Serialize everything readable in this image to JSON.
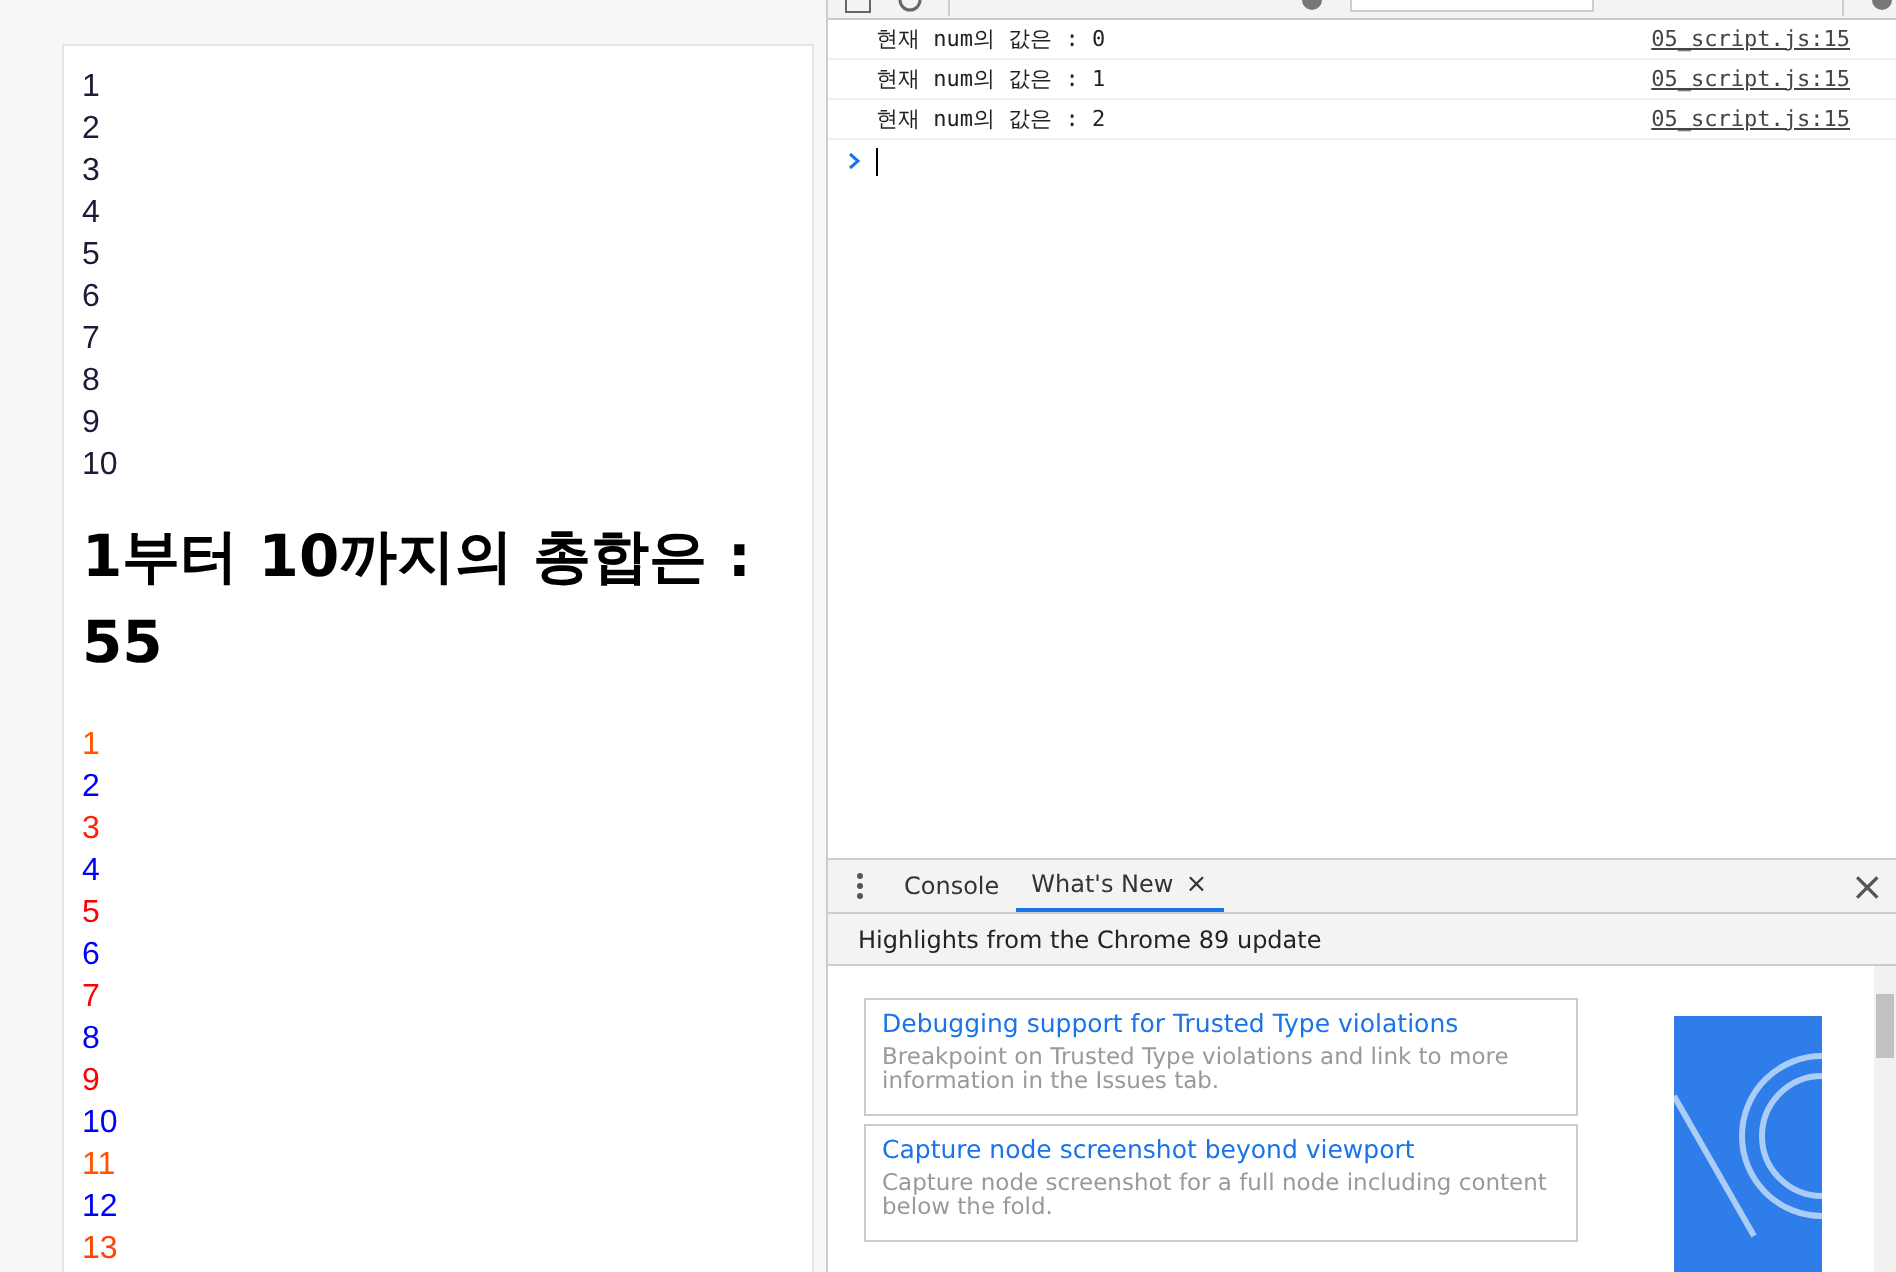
{
  "page": {
    "first_list": [
      "1",
      "2",
      "3",
      "4",
      "5",
      "6",
      "7",
      "8",
      "9",
      "10"
    ],
    "heading": "1부터 10까지의 총합은 : 55",
    "second_list": [
      {
        "text": "1",
        "color": "#ff5500"
      },
      {
        "text": "2",
        "color": "#0000ff"
      },
      {
        "text": "3",
        "color": "#ff2200"
      },
      {
        "text": "4",
        "color": "#0000ff"
      },
      {
        "text": "5",
        "color": "#ff0000"
      },
      {
        "text": "6",
        "color": "#0000ff"
      },
      {
        "text": "7",
        "color": "#ff0000"
      },
      {
        "text": "8",
        "color": "#0000ff"
      },
      {
        "text": "9",
        "color": "#ff0000"
      },
      {
        "text": "10",
        "color": "#0000ff"
      },
      {
        "text": "11",
        "color": "#ff5500"
      },
      {
        "text": "12",
        "color": "#0000ff"
      },
      {
        "text": "13",
        "color": "#ff4400"
      }
    ]
  },
  "console": {
    "messages": [
      {
        "text": "현재 num의 값은 : 0",
        "source": "05_script.js:15"
      },
      {
        "text": "현재 num의 값은 : 1",
        "source": "05_script.js:15"
      },
      {
        "text": "현재 num의 값은 : 2",
        "source": "05_script.js:15"
      }
    ]
  },
  "drawer": {
    "tabs": [
      {
        "label": "Console",
        "selected": false,
        "closable": false
      },
      {
        "label": "What's New",
        "selected": true,
        "closable": true
      }
    ],
    "close": "×",
    "tab_close": "×",
    "header": "Highlights from the Chrome 89 update",
    "cards": [
      {
        "title": "Debugging support for Trusted Type violations",
        "description": "Breakpoint on Trusted Type violations and link to more information in the Issues tab."
      },
      {
        "title": "Capture node screenshot beyond viewport",
        "description": "Capture node screenshot for a full node including content below the fold."
      }
    ]
  }
}
